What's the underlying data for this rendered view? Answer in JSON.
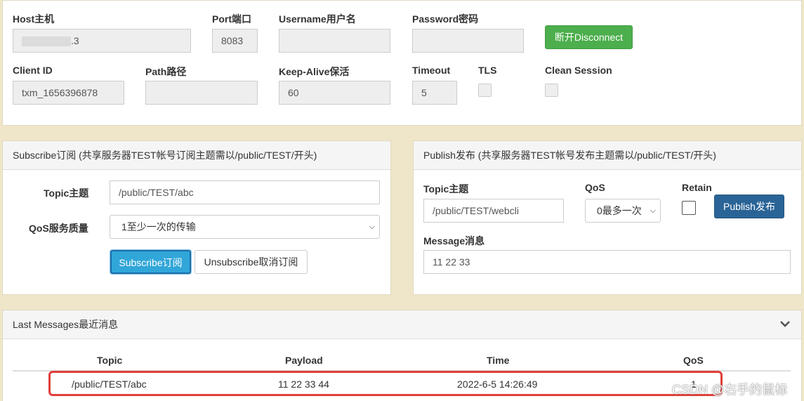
{
  "connection": {
    "host_label": "Host主机",
    "host_value": ".3",
    "port_label": "Port端口",
    "port_value": "8083",
    "username_label": "Username用户名",
    "username_value": "",
    "password_label": "Password密码",
    "password_value": "",
    "disconnect_label": "断开Disconnect",
    "clientid_label": "Client ID",
    "clientid_value": "txm_1656396878",
    "path_label": "Path路径",
    "path_value": "",
    "keepalive_label": "Keep-Alive保活",
    "keepalive_value": "60",
    "timeout_label": "Timeout",
    "timeout_value": "5",
    "tls_label": "TLS",
    "clean_session_label": "Clean Session"
  },
  "subscribe": {
    "heading": "Subscribe订阅 (共享服务器TEST帐号订阅主题需以/public/TEST/开头)",
    "topic_label": "Topic主题",
    "topic_value": "/public/TEST/abc",
    "qos_label": "QoS服务质量",
    "qos_selected": "1至少一次的传输",
    "subscribe_label": "Subscribe订阅",
    "unsubscribe_label": "Unsubscribe取消订阅"
  },
  "publish": {
    "heading": "Publish发布 (共享服务器TEST帐号发布主题需以/public/TEST/开头)",
    "topic_label": "Topic主题",
    "topic_value": "/public/TEST/webcli",
    "qos_label": "QoS",
    "qos_selected": "0最多一次",
    "retain_label": "Retain",
    "publish_label": "Publish发布",
    "message_label": "Message消息",
    "message_value": "11 22 33"
  },
  "messages": {
    "heading": "Last Messages最近消息",
    "columns": [
      "Topic",
      "Payload",
      "Time",
      "QoS"
    ],
    "rows": [
      {
        "topic": "/public/TEST/abc",
        "payload": "11 22 33 44",
        "time": "2022-6-5 14:26:49",
        "qos": "1"
      }
    ]
  },
  "watermark": "CSDN @右手的鼠标",
  "icons": {
    "chevron": "chevron-down-icon",
    "select_arrow": "select-arrow-icon"
  },
  "colors": {
    "background": "#efe6c9",
    "disconnect_button": "#4cae4c",
    "publish_button": "#2a6496",
    "subscribe_button": "#31a6d8",
    "highlight_box": "#e0403a"
  }
}
